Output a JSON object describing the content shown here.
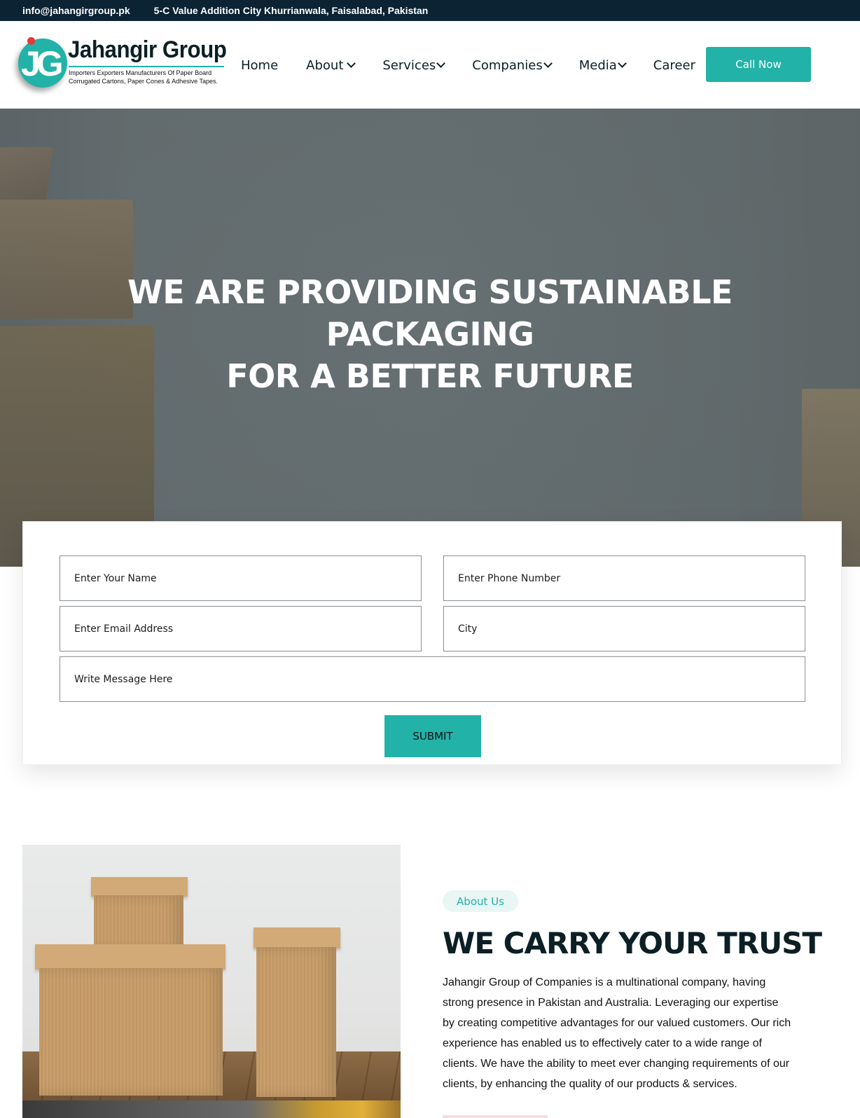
{
  "topbar": {
    "email": "info@jahangirgroup.pk",
    "address": "5-C Value Addition City Khurrianwala, Faisalabad, Pakistan"
  },
  "logo": {
    "mark": "JG",
    "title": "Jahangir Group",
    "tagline_line1": "Importers Exporters Manufacturers Of Paper Board",
    "tagline_line2": "Corrugated Cartons, Paper Cones & Adhesive Tapes."
  },
  "nav": {
    "items": [
      {
        "label": "Home"
      },
      {
        "label": "About"
      },
      {
        "label": "Services"
      },
      {
        "label": "Companies"
      },
      {
        "label": "Media"
      },
      {
        "label": "Career"
      }
    ],
    "cta_label": "Call Now"
  },
  "hero": {
    "line1": "WE ARE PROVIDING SUSTAINABLE",
    "line2": "PACKAGING",
    "line3": "FOR A BETTER FUTURE"
  },
  "form": {
    "name_placeholder": "Enter Your Name",
    "phone_placeholder": "Enter Phone Number",
    "email_placeholder": "Enter Email Address",
    "city_placeholder": "City",
    "message_placeholder": "Write Message Here",
    "submit_label": "SUBMIT"
  },
  "about": {
    "badge": "About Us",
    "title": "WE CARRY YOUR TRUST",
    "text_lines": [
      "Jahangir Group of Companies is a multinational company, having",
      "strong presence in Pakistan and Australia. Leveraging our expertise",
      "by creating competitive advantages for our valued customers. Our rich",
      "experience has enabled us to effectively cater to a wide range of",
      "clients. We have the ability to meet ever changing requirements of our",
      "clients, by enhancing the quality of our products & services."
    ]
  },
  "colors": {
    "accent": "#22b2a8",
    "topbar_bg": "#0b2333",
    "heading": "#0b1f25"
  }
}
